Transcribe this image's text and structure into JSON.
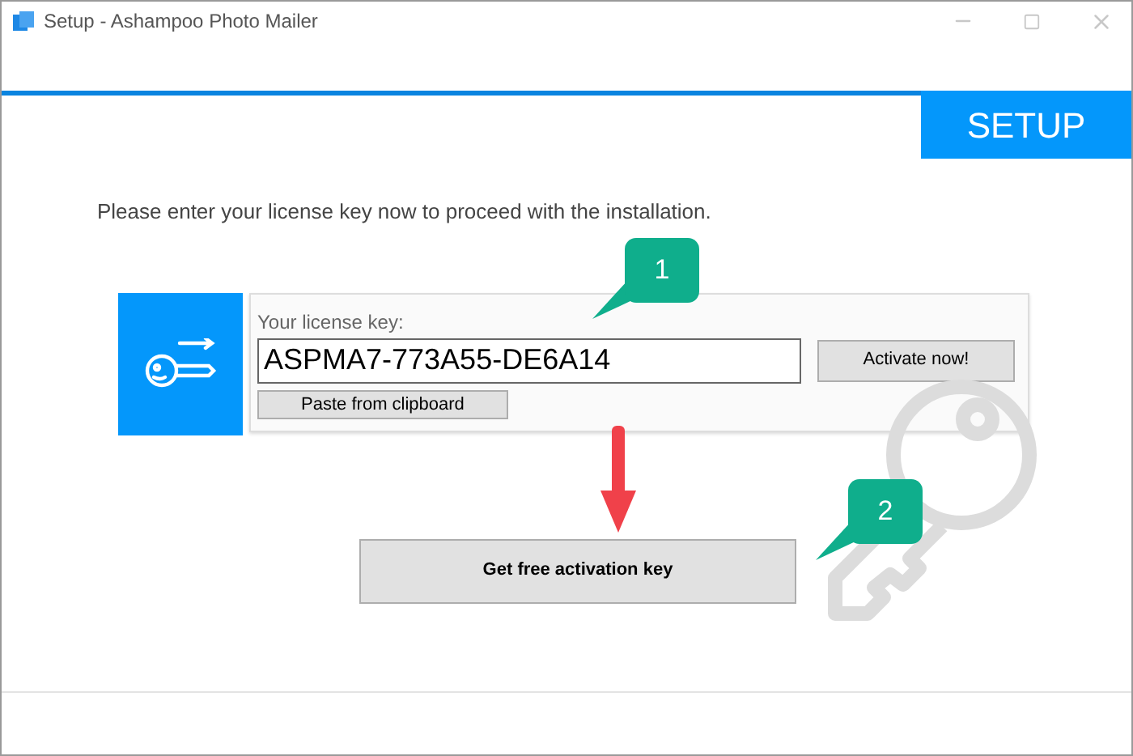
{
  "window": {
    "title": "Setup - Ashampoo Photo Mailer"
  },
  "banner": {
    "title": "SETUP"
  },
  "instruction": "Please enter your license key now to proceed with the installation.",
  "license": {
    "label": "Your license key:",
    "value": "ASPMA7-773A55-DE6A14",
    "activate_button": "Activate now!",
    "paste_button": "Paste from clipboard"
  },
  "get_key_button": "Get free activation key",
  "callouts": [
    "1",
    "2"
  ]
}
